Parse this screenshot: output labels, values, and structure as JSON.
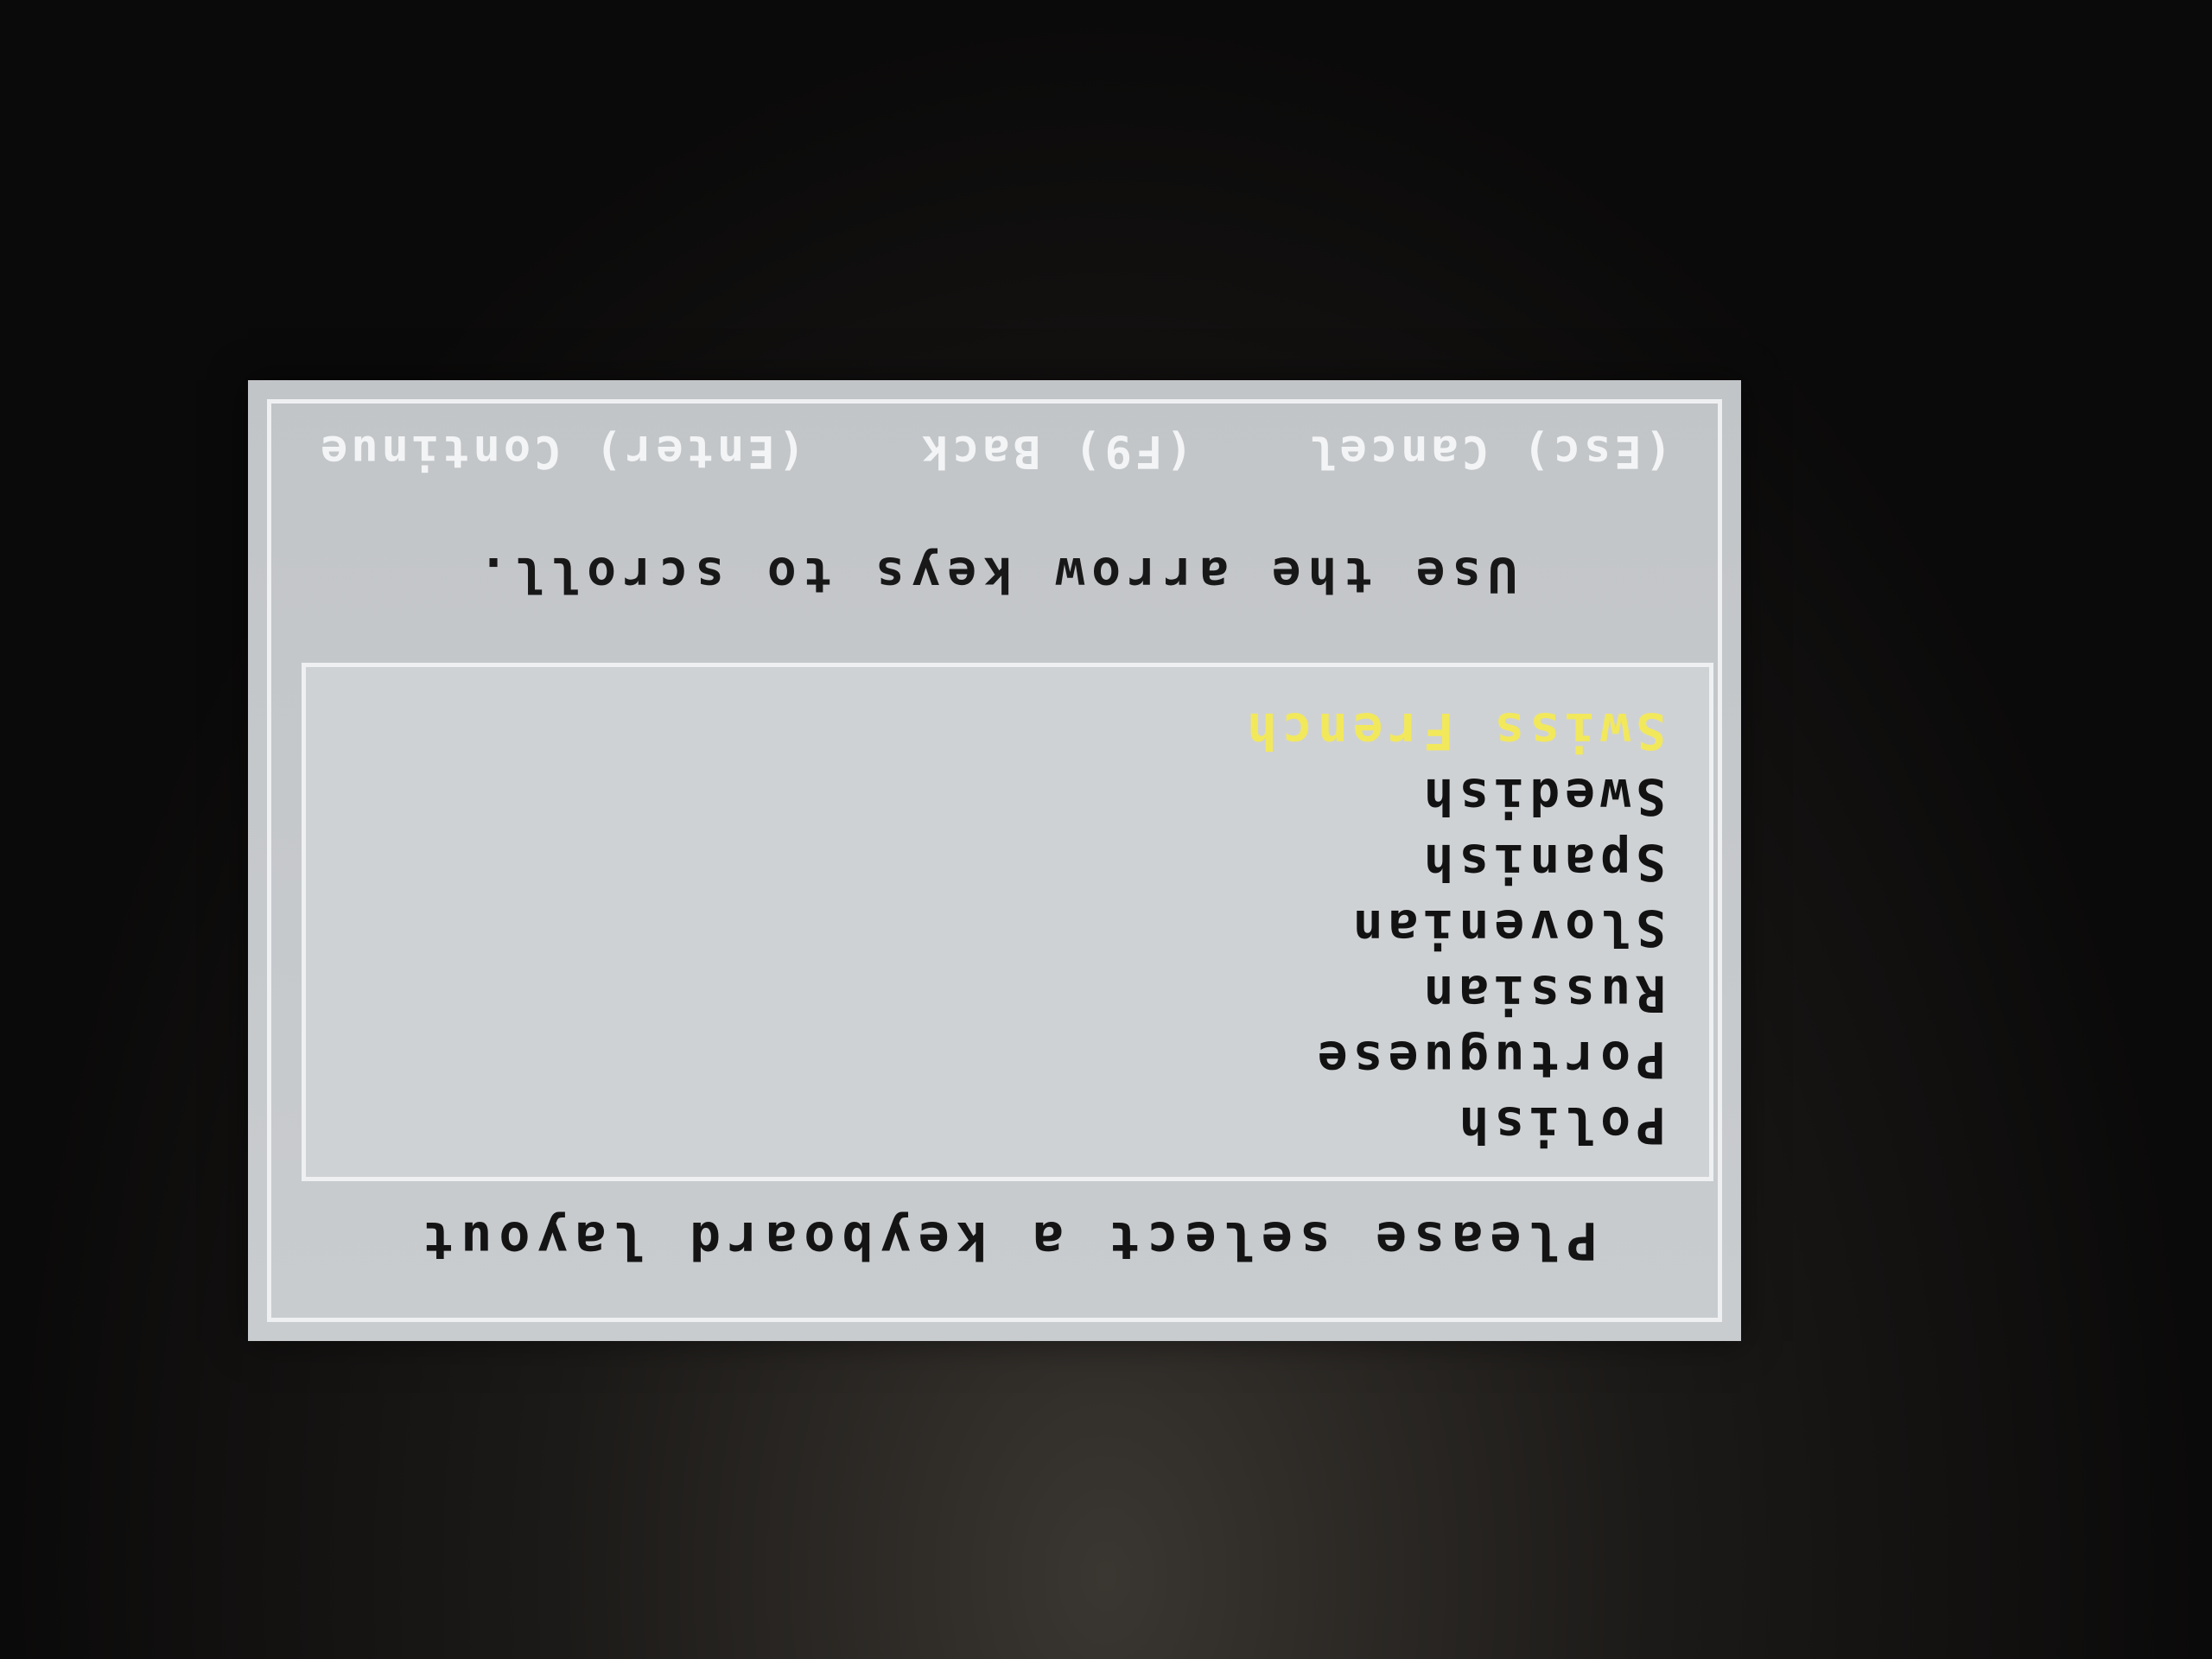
{
  "dialog": {
    "title": "Please select a keyboard layout",
    "hint": "Use the arrow keys to scroll.",
    "layouts": [
      {
        "label": "Polish",
        "selected": false
      },
      {
        "label": "Portuguese",
        "selected": false
      },
      {
        "label": "Russian",
        "selected": false
      },
      {
        "label": "Slovenian",
        "selected": false
      },
      {
        "label": "Spanish",
        "selected": false
      },
      {
        "label": "Swedish",
        "selected": false
      },
      {
        "label": "Swiss French",
        "selected": true
      }
    ],
    "keys": {
      "cancel": "(Esc) Cancel",
      "back": "(F9) Back",
      "continue": "(Enter) Continue"
    }
  },
  "colors": {
    "background": "#0b0a0a",
    "dialog": "#c6c9cc",
    "border": "#eef0f2",
    "selected_text": "#f2e85c",
    "key_text": "#f3f4f5"
  }
}
